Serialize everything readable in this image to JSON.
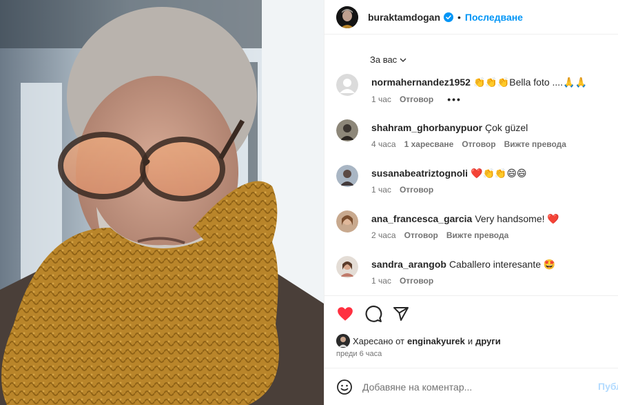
{
  "post": {
    "username": "buraktamdogan",
    "separator": "•",
    "follow_label": "Последване"
  },
  "filter": {
    "label": "За вас",
    "icon": "chevron-down-icon"
  },
  "comments": [
    {
      "user": "normahernandez1952",
      "text": "👏👏👏Bella foto ....🙏🙏",
      "time": "1 час",
      "likes": "",
      "reply": "Отговор",
      "translate": "",
      "more": "•••"
    },
    {
      "user": "shahram_ghorbanypuor",
      "text": "Çok güzel",
      "time": "4 часа",
      "likes": "1 харесване",
      "reply": "Отговор",
      "translate": "Вижте превода"
    },
    {
      "user": "susanabeatriztognoli",
      "text": "❤️👏👏😄😄",
      "time": "1 час",
      "likes": "",
      "reply": "Отговор",
      "translate": ""
    },
    {
      "user": "ana_francesca_garcia",
      "text": "Very handsome! ❤️",
      "time": "2 часа",
      "likes": "",
      "reply": "Отговор",
      "translate": "Вижте превода"
    },
    {
      "user": "sandra_arangob",
      "text": "Caballero interesante 🤩",
      "time": "1 час",
      "likes": "",
      "reply": "Отговор",
      "translate": ""
    }
  ],
  "actions": {
    "like_icon": "heart-filled-icon",
    "comment_icon": "comment-icon",
    "share_icon": "share-icon",
    "like_color": "#ff3040"
  },
  "likes": {
    "prefix": "Харесано от",
    "user": "enginakyurek",
    "conj": "и",
    "others": "други"
  },
  "time_ago": "преди 6 часа",
  "add_comment": {
    "placeholder": "Добавяне на коментар...",
    "post_label": "Публ",
    "emoji_icon": "emoji-icon"
  },
  "colors": {
    "accent": "#0095f6",
    "post_disabled": "#b3dbff",
    "verified": "#0095f6"
  }
}
